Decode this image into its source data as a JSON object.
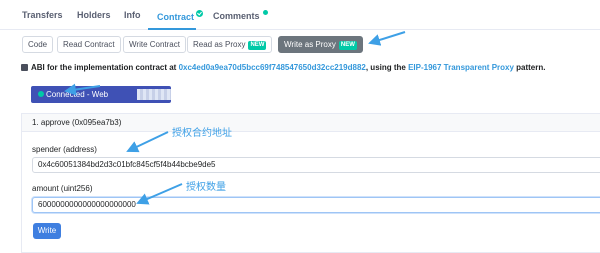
{
  "tabs": [
    {
      "label": "Transfers"
    },
    {
      "label": "Holders"
    },
    {
      "label": "Info"
    },
    {
      "label": "Contract"
    },
    {
      "label": "Comments"
    }
  ],
  "subtabs": {
    "code": "Code",
    "read_contract": "Read Contract",
    "write_contract": "Write Contract",
    "read_proxy": "Read as Proxy",
    "write_proxy": "Write as Proxy",
    "new_badge": "NEW"
  },
  "abi": {
    "prefix": "ABI for the implementation contract at ",
    "address": "0xc4ed0a9ea70d5bcc69f748547650d32cc219d882",
    "middle": ", using the ",
    "proxy_link": "EIP-1967 Transparent Proxy",
    "suffix": " pattern."
  },
  "connect": {
    "label": "Connected - Web"
  },
  "method": {
    "title": "1. approve (0x095ea7b3)",
    "spender_label": "spender (address)",
    "spender_value": "0x4c60051384bd2d3c01bfc845cf5f4b44bcbe9de5",
    "amount_label": "amount (uint256)",
    "amount_value": "6000000000000000000000",
    "write_label": "Write"
  },
  "annotations": {
    "spender_note": "授权合约地址",
    "amount_note": "授权数量"
  },
  "colors": {
    "accent": "#3498db",
    "connected": "#3f51b5",
    "annotation": "#3ea0e6",
    "new_badge": "#00c9a7"
  }
}
